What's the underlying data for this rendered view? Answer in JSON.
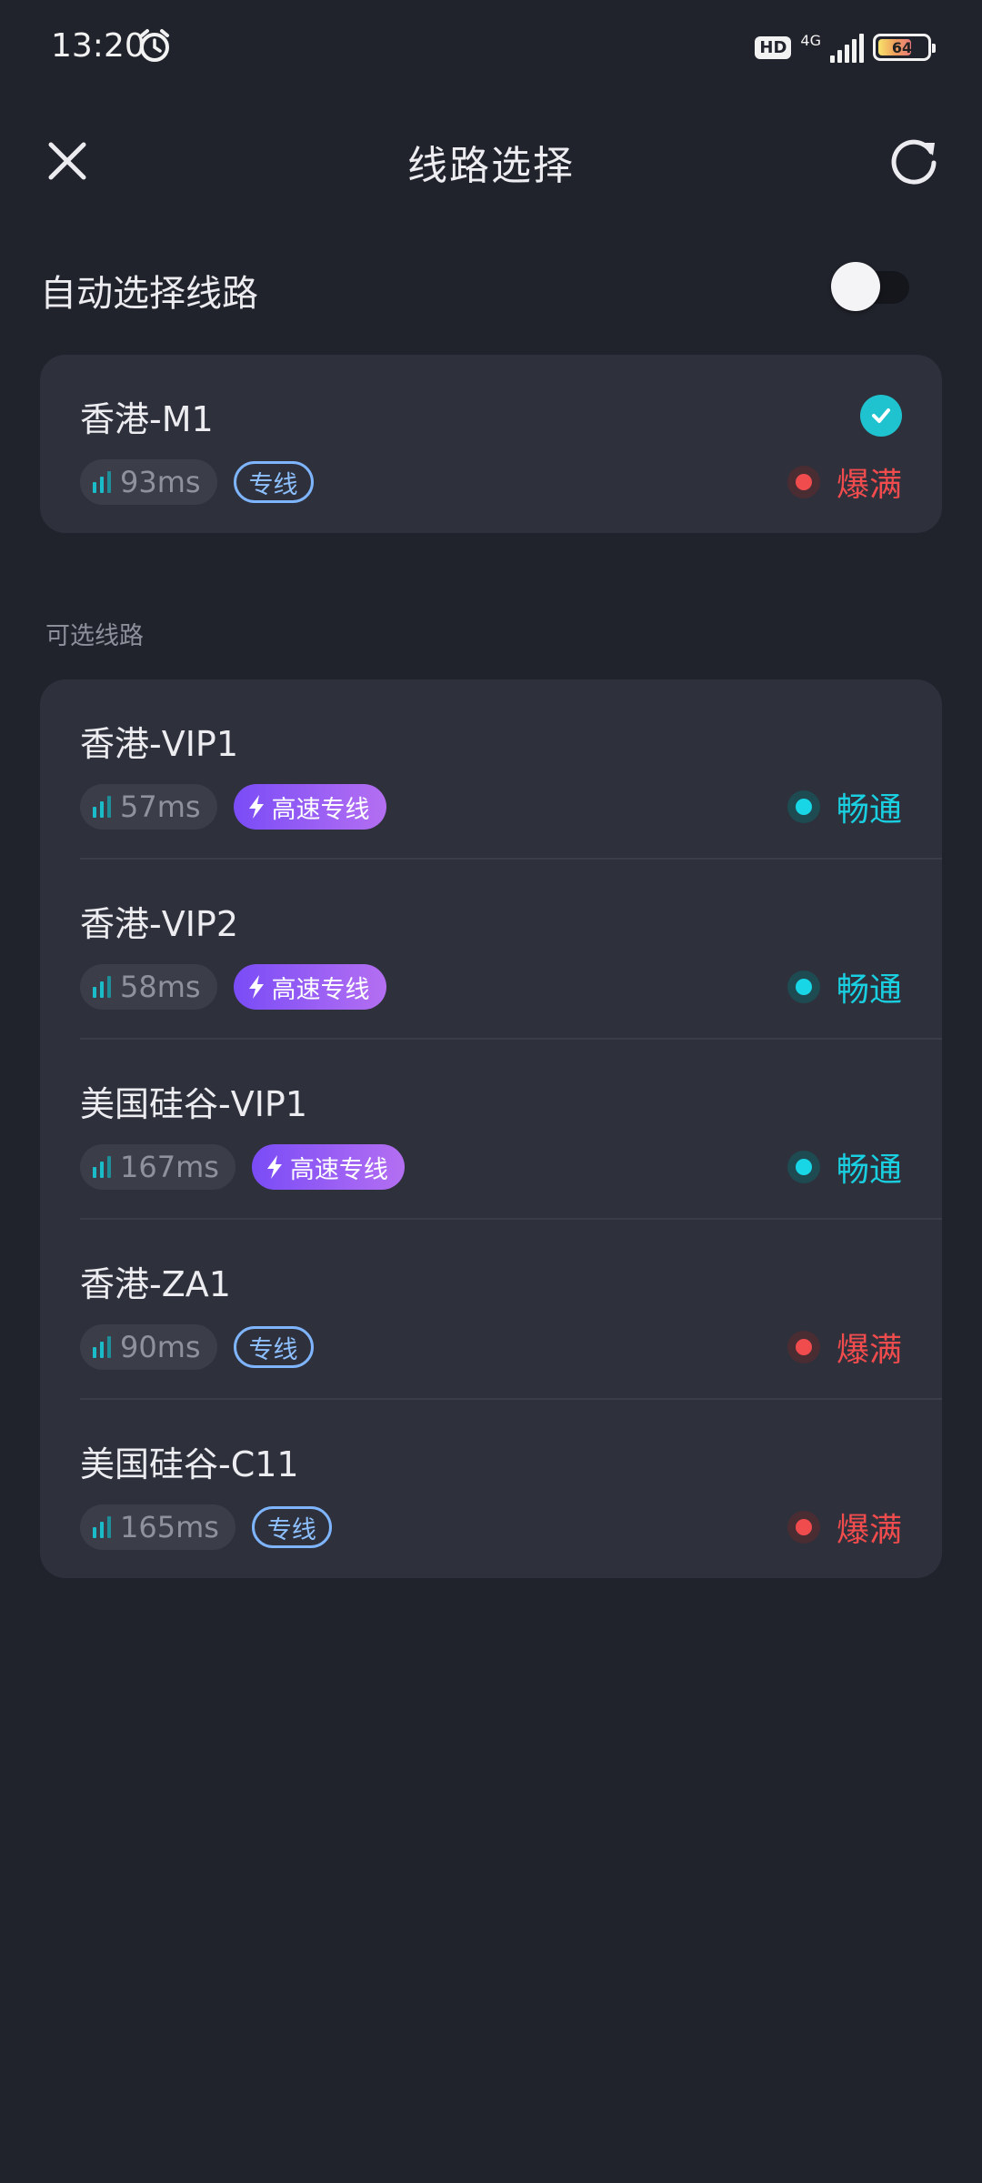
{
  "status_bar": {
    "time": "13:20",
    "hd": "HD",
    "network": "4G",
    "battery": "64"
  },
  "header": {
    "title": "线路选择"
  },
  "auto_select": {
    "label": "自动选择线路",
    "enabled": false
  },
  "current": {
    "name": "香港-M1",
    "latency": "93ms",
    "tag": "专线",
    "status": "爆满",
    "status_color": "#f04b4d",
    "selected": true
  },
  "section_label": "可选线路",
  "routes": [
    {
      "name": "香港-VIP1",
      "latency": "57ms",
      "tag": "高速专线",
      "tag_type": "fast",
      "status": "畅通",
      "status_type": "cyan"
    },
    {
      "name": "香港-VIP2",
      "latency": "58ms",
      "tag": "高速专线",
      "tag_type": "fast",
      "status": "畅通",
      "status_type": "cyan"
    },
    {
      "name": "美国硅谷-VIP1",
      "latency": "167ms",
      "tag": "高速专线",
      "tag_type": "fast",
      "status": "畅通",
      "status_type": "cyan"
    },
    {
      "name": "香港-ZA1",
      "latency": "90ms",
      "tag": "专线",
      "tag_type": "line",
      "status": "爆满",
      "status_type": "red"
    },
    {
      "name": "美国硅谷-C11",
      "latency": "165ms",
      "tag": "专线",
      "tag_type": "line",
      "status": "爆满",
      "status_type": "red"
    }
  ],
  "colors": {
    "background": "#21232c",
    "card": "#2e313c",
    "accent_cyan": "#19cfe0",
    "status_red": "#f04b4d",
    "tag_line": "#7fb5ff",
    "tag_fast_start": "#7a4cf6",
    "tag_fast_end": "#b46ff2"
  },
  "icons": {
    "close": "close-icon",
    "refresh": "refresh-icon",
    "check": "check-circle-icon",
    "latency": "signal-bars-icon",
    "fast": "lightning-icon",
    "alarm": "alarm-clock-icon"
  }
}
